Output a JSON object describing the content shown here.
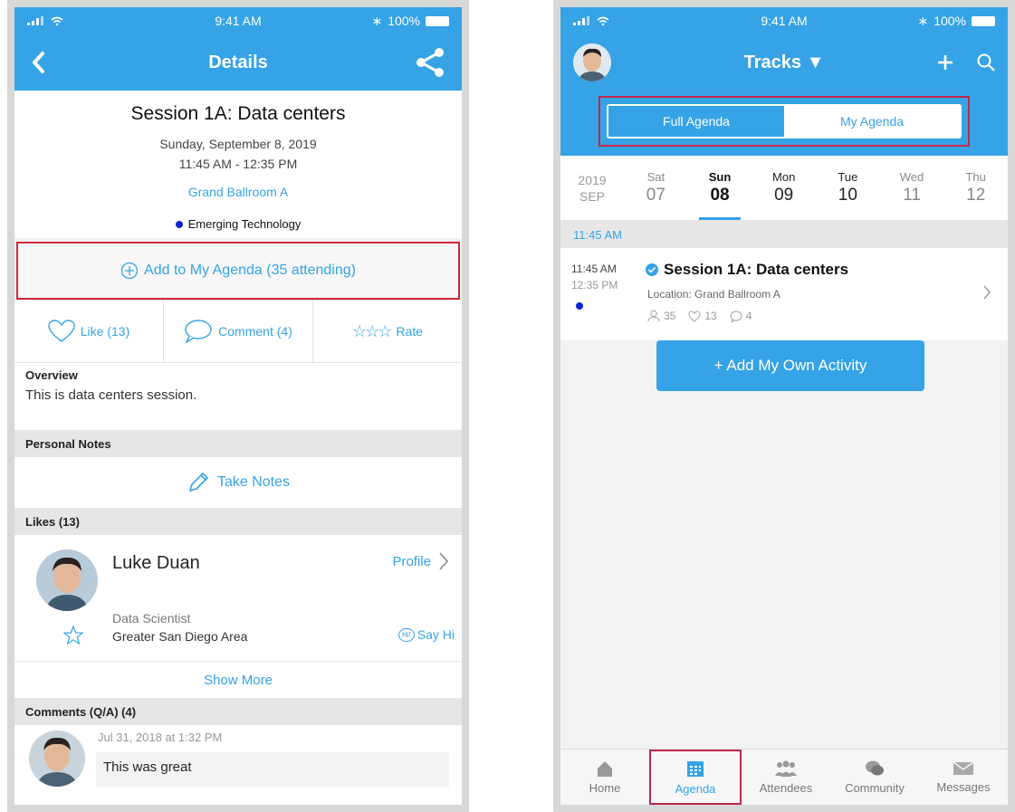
{
  "status": {
    "time": "9:41 AM",
    "battery": "100%"
  },
  "details": {
    "nav_title": "Details",
    "session_title": "Session 1A: Data centers",
    "date": "Sunday, September 8, 2019",
    "time_range": "11:45 AM - 12:35 PM",
    "room": "Grand Ballroom A",
    "track": "Emerging Technology",
    "track_color": "#0b22d6",
    "add_agenda_label": "Add to My Agenda (35 attending)",
    "like_label": "Like (13)",
    "comment_label": "Comment (4)",
    "rate_label": "Rate",
    "overview_label": "Overview",
    "overview_text": "This is data centers session.",
    "personal_notes_label": "Personal Notes",
    "take_notes_label": "Take Notes",
    "likes_label": "Likes  (13)",
    "liker": {
      "name": "Luke Duan",
      "profile_label": "Profile",
      "role": "Data Scientist",
      "area": "Greater San Diego Area",
      "say_hi_label": "Say Hi",
      "hi_badge": "Hi!"
    },
    "show_more_label": "Show More",
    "comments_label": "Comments (Q/A)  (4)",
    "comment": {
      "date": "Jul 31, 2018 at 1:32 PM",
      "text": "This was great"
    }
  },
  "agenda": {
    "nav_title": "Tracks",
    "segments": {
      "full": "Full Agenda",
      "my": "My Agenda"
    },
    "year": "2019",
    "month": "SEP",
    "days": [
      {
        "name": "Sat",
        "num": "07"
      },
      {
        "name": "Sun",
        "num": "08"
      },
      {
        "name": "Mon",
        "num": "09"
      },
      {
        "name": "Tue",
        "num": "10"
      },
      {
        "name": "Wed",
        "num": "11"
      },
      {
        "name": "Thu",
        "num": "12"
      }
    ],
    "time_heading": "11:45 AM",
    "event": {
      "start": "11:45 AM",
      "end": "12:35 PM",
      "title": "Session 1A: Data centers",
      "location": "Location: Grand Ballroom A",
      "attendees": "35",
      "likes": "13",
      "comments": "4"
    },
    "own_activity_label": "+ Add My Own Activity",
    "tabs": [
      {
        "label": "Home",
        "icon": "home-icon"
      },
      {
        "label": "Agenda",
        "icon": "calendar-icon"
      },
      {
        "label": "Attendees",
        "icon": "attendees-icon"
      },
      {
        "label": "Community",
        "icon": "community-icon"
      },
      {
        "label": "Messages",
        "icon": "envelope-icon"
      }
    ]
  },
  "colors": {
    "brand_blue": "#35a3e6",
    "highlight_red": "#c2274a"
  }
}
